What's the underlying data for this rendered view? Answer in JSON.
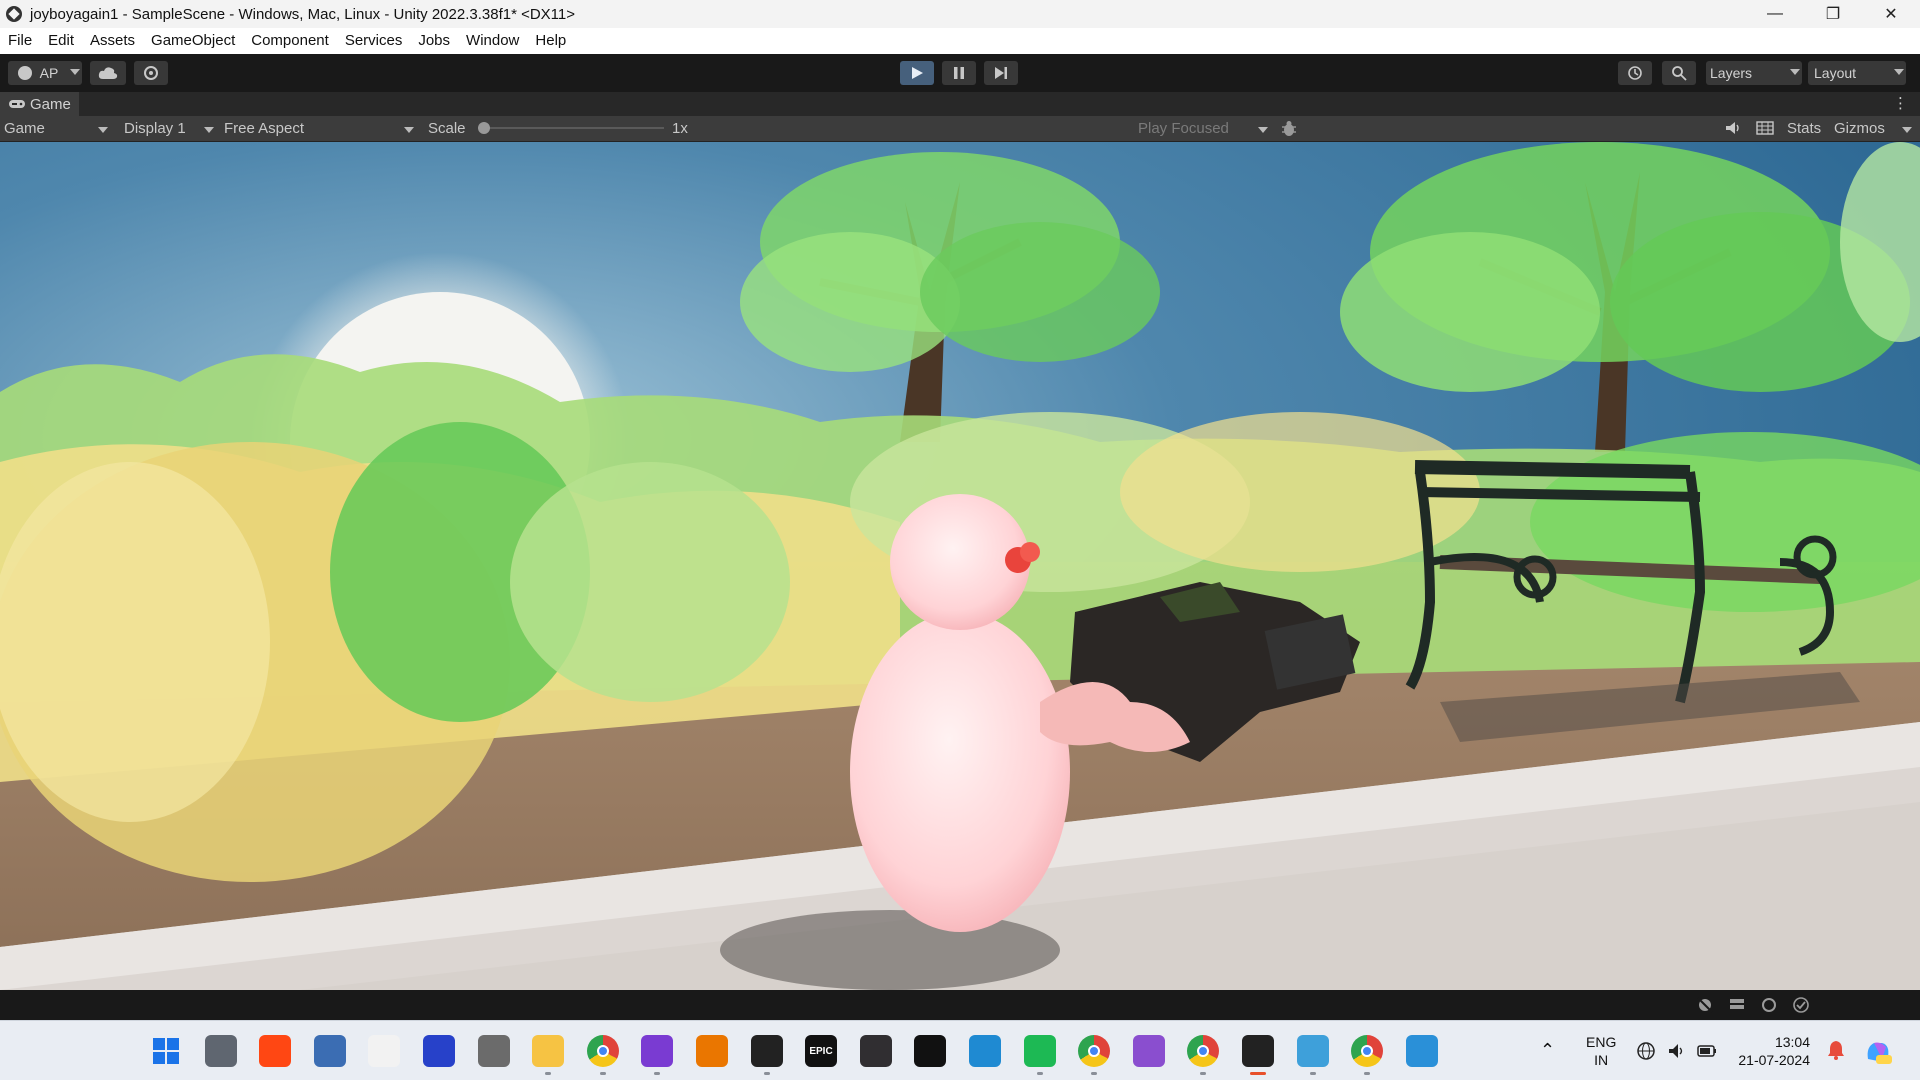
{
  "window": {
    "title": "joyboyagain1 - SampleScene - Windows, Mac, Linux - Unity 2022.3.38f1* <DX11>",
    "minimize_glyph": "—",
    "maximize_glyph": "❐",
    "close_glyph": "✕"
  },
  "menu": [
    "File",
    "Edit",
    "Assets",
    "GameObject",
    "Component",
    "Services",
    "Jobs",
    "Window",
    "Help"
  ],
  "toolbar": {
    "account_label": "AP",
    "layers_label": "Layers",
    "layout_label": "Layout",
    "play_state": "playing"
  },
  "game_tab": {
    "label": "Game"
  },
  "game_bar": {
    "view_mode": "Game",
    "display": "Display 1",
    "aspect": "Free Aspect",
    "scale_label": "Scale",
    "scale_value": "1x",
    "scale_level": 0.0,
    "play_mode": "Play Focused",
    "stats_label": "Stats",
    "gizmos_label": "Gizmos"
  },
  "taskbar": {
    "apps": [
      {
        "name": "start-icon",
        "color": "#1a73e8"
      },
      {
        "name": "task-view-icon",
        "color": "#5f6670"
      },
      {
        "name": "houdini-icon",
        "color": "#ff4713"
      },
      {
        "name": "settings-icon",
        "color": "#3b6db3"
      },
      {
        "name": "ms-store-icon",
        "color": "#f2f2f2"
      },
      {
        "name": "app-blue-icon",
        "color": "#2741c9"
      },
      {
        "name": "app-dark-icon",
        "color": "#6b6b6b"
      },
      {
        "name": "file-explorer-icon",
        "color": "#f6c343"
      },
      {
        "name": "chrome-icon",
        "color": "#e0433a"
      },
      {
        "name": "github-desktop-icon",
        "color": "#7a3bd2"
      },
      {
        "name": "blender-icon",
        "color": "#ea7600"
      },
      {
        "name": "unity-hub-icon",
        "color": "#222"
      },
      {
        "name": "epic-games-icon",
        "color": "#111"
      },
      {
        "name": "obs-icon",
        "color": "#302e31"
      },
      {
        "name": "unreal-icon",
        "color": "#111"
      },
      {
        "name": "vscode-icon",
        "color": "#1f8ad2"
      },
      {
        "name": "spotify-icon",
        "color": "#1db954"
      },
      {
        "name": "chrome-profile-icon",
        "color": "#e0433a"
      },
      {
        "name": "visual-studio-icon",
        "color": "#8a4ecf"
      },
      {
        "name": "chrome-profile2-icon",
        "color": "#e0433a"
      },
      {
        "name": "unity-editor-icon",
        "color": "#222"
      },
      {
        "name": "notepad-icon",
        "color": "#3ea0da"
      },
      {
        "name": "chrome-profile3-icon",
        "color": "#e0433a"
      },
      {
        "name": "photos-icon",
        "color": "#2a90d8"
      }
    ],
    "epic_text": "EPIC",
    "lang_line1": "ENG",
    "lang_line2": "IN",
    "time": "13:04",
    "date": "21-07-2024"
  }
}
